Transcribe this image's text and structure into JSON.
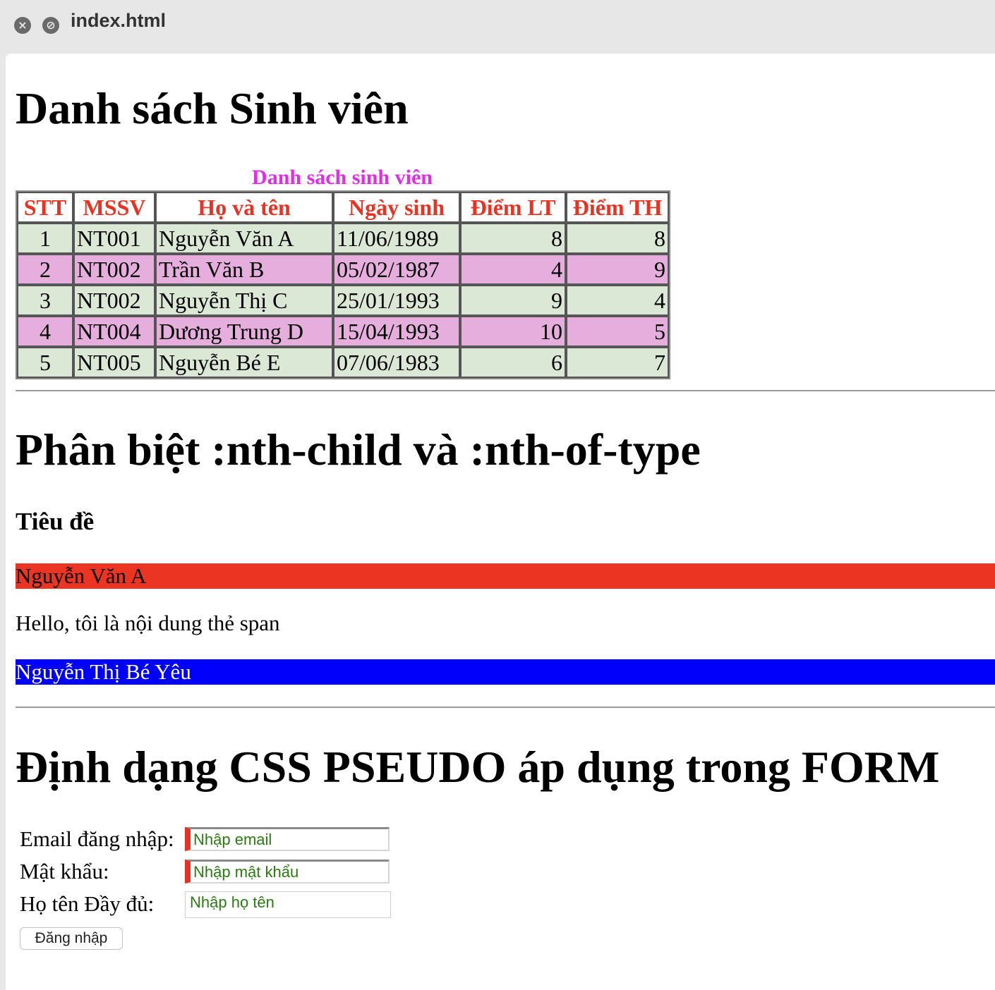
{
  "window": {
    "title": "index.html"
  },
  "section1": {
    "heading": "Danh sách Sinh viên",
    "table": {
      "caption": "Danh sách sinh viên",
      "headers": [
        "STT",
        "MSSV",
        "Họ và tên",
        "Ngày sinh",
        "Điểm LT",
        "Điểm TH"
      ],
      "rows": [
        [
          "1",
          "NT001",
          "Nguyễn Văn A",
          "11/06/1989",
          "8",
          "8"
        ],
        [
          "2",
          "NT002",
          "Trần Văn B",
          "05/02/1987",
          "4",
          "9"
        ],
        [
          "3",
          "NT002",
          "Nguyễn Thị C",
          "25/01/1993",
          "9",
          "4"
        ],
        [
          "4",
          "NT004",
          "Dương Trung D",
          "15/04/1993",
          "10",
          "5"
        ],
        [
          "5",
          "NT005",
          "Nguyễn Bé E",
          "07/06/1983",
          "6",
          "7"
        ]
      ],
      "header_color": "#e83323",
      "odd_row_color": "#dbe8d6",
      "even_row_color": "#e5aedd"
    }
  },
  "section2": {
    "heading": "Phân biệt :nth-child và :nth-of-type",
    "subheading": "Tiêu đề",
    "red_text": "Nguyễn Văn A",
    "span_text": "Hello, tôi là nội dung thẻ span",
    "blue_text": "Nguyễn Thị Bé Yêu",
    "red_color": "#ec3423",
    "blue_color": "#0000fb"
  },
  "section3": {
    "heading": "Định dạng CSS PSEUDO áp dụng trong FORM",
    "form": {
      "email_label": "Email đăng nhập:",
      "email_placeholder": "Nhập email",
      "password_label": "Mật khẩu:",
      "password_placeholder": "Nhập mật khẩu",
      "fullname_label": "Họ tên Đầy đủ:",
      "fullname_placeholder": "Nhập họ tên",
      "submit_label": "Đăng nhập"
    }
  }
}
